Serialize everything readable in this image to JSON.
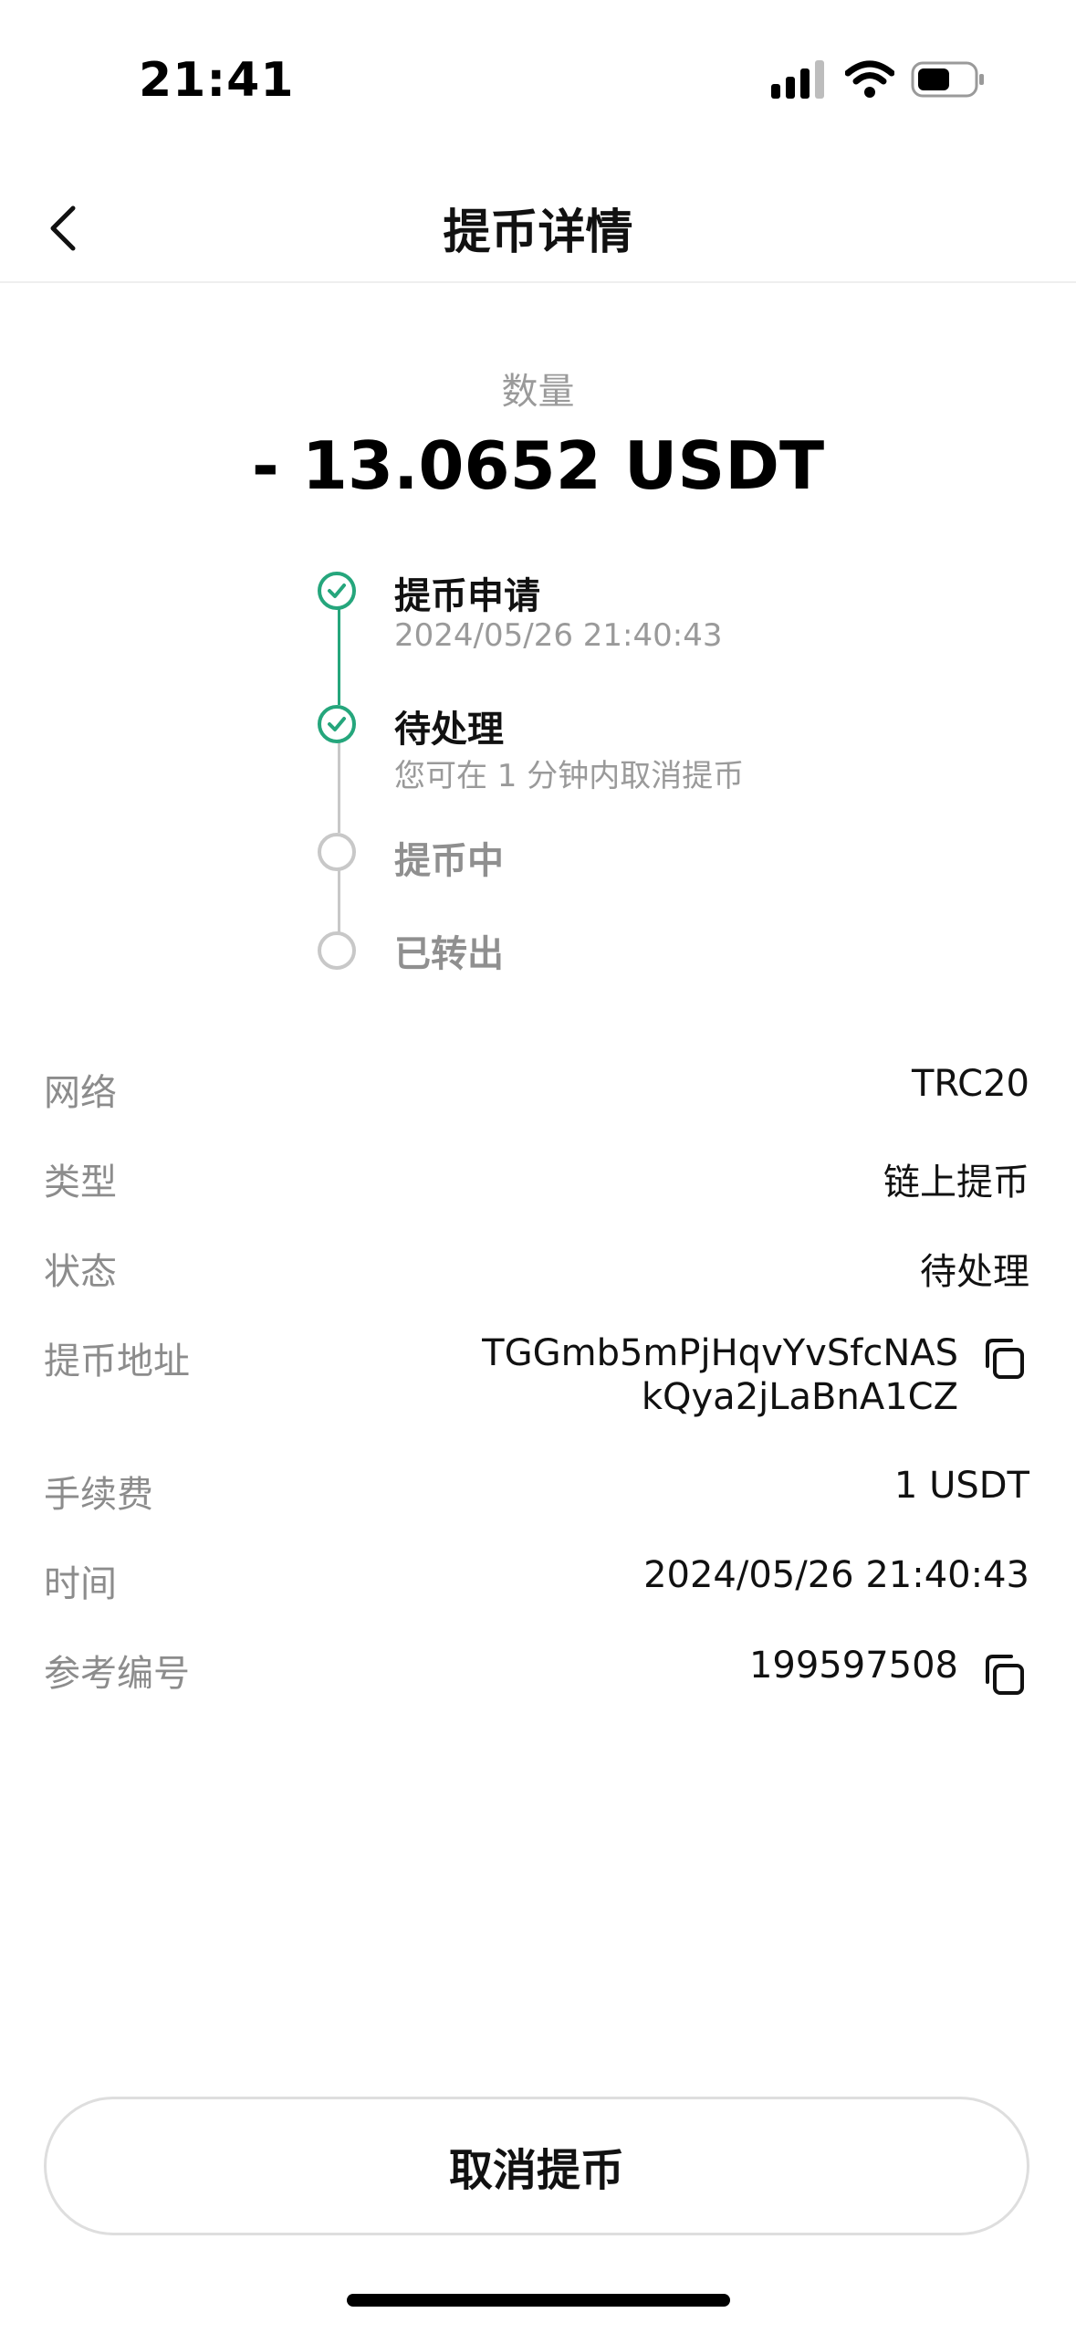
{
  "status_bar": {
    "time": "21:41"
  },
  "header": {
    "title": "提币详情"
  },
  "amount": {
    "label": "数量",
    "value": "- 13.0652 USDT"
  },
  "timeline": [
    {
      "title": "提币申请",
      "subtitle": "2024/05/26 21:40:43",
      "state": "done"
    },
    {
      "title": "待处理",
      "subtitle": "您可在 1 分钟内取消提币",
      "state": "done"
    },
    {
      "title": "提币中",
      "subtitle": "",
      "state": "pending"
    },
    {
      "title": "已转出",
      "subtitle": "",
      "state": "pending"
    }
  ],
  "details": {
    "network": {
      "label": "网络",
      "value": "TRC20"
    },
    "type": {
      "label": "类型",
      "value": "链上提币"
    },
    "status": {
      "label": "状态",
      "value": "待处理"
    },
    "address": {
      "label": "提币地址",
      "line1": "TGGmb5mPjHqvYvSfcNAS",
      "line2": "kQya2jLaBnA1CZ"
    },
    "fee": {
      "label": "手续费",
      "value": "1 USDT"
    },
    "time": {
      "label": "时间",
      "value": "2024/05/26 21:40:43"
    },
    "reference": {
      "label": "参考编号",
      "value": "199597508"
    }
  },
  "actions": {
    "cancel_label": "取消提币"
  },
  "colors": {
    "accent": "#25a67c",
    "inactive": "#c8c8c8"
  },
  "icons": [
    "back-chevron-icon",
    "check-icon",
    "copy-icon",
    "signal-icon",
    "wifi-icon",
    "battery-icon"
  ]
}
